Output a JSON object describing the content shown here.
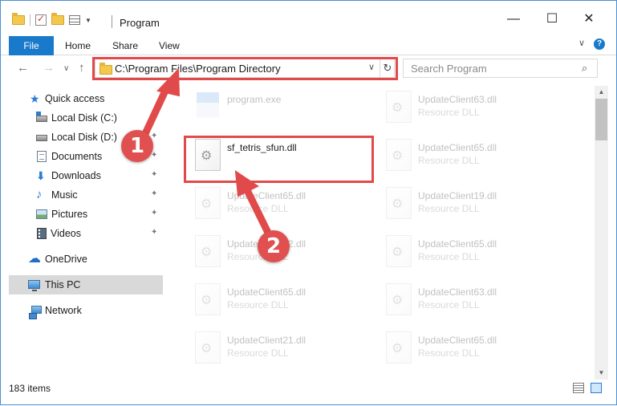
{
  "window": {
    "title": "Program",
    "minimize_glyph": "—",
    "maximize_glyph": "☐",
    "close_glyph": "✕"
  },
  "ribbon": {
    "tabs": [
      {
        "label": "File"
      },
      {
        "label": "Home"
      },
      {
        "label": "Share"
      },
      {
        "label": "View"
      }
    ],
    "expand_glyph": "∨",
    "help_glyph": "?"
  },
  "nav": {
    "back_glyph": "←",
    "forward_glyph": "→",
    "recent_glyph": "∨",
    "up_glyph": "↑",
    "address": "C:\\Program Files\\Program Directory",
    "address_dropdown_glyph": "∨",
    "refresh_glyph": "↻",
    "search_placeholder": "Search Program",
    "search_glyph": "⌕"
  },
  "sidebar": {
    "items": [
      {
        "label": "Quick access",
        "icon": "star-icon",
        "pinned": false
      },
      {
        "label": "Local Disk (C:)",
        "icon": "drive-icon",
        "pinned": true
      },
      {
        "label": "Local Disk (D:)",
        "icon": "drive-icon",
        "pinned": true
      },
      {
        "label": "Documents",
        "icon": "documents-icon",
        "pinned": true
      },
      {
        "label": "Downloads",
        "icon": "downloads-icon",
        "pinned": true
      },
      {
        "label": "Music",
        "icon": "music-icon",
        "pinned": true
      },
      {
        "label": "Pictures",
        "icon": "pictures-icon",
        "pinned": true
      },
      {
        "label": "Videos",
        "icon": "videos-icon",
        "pinned": true
      },
      {
        "label": "OneDrive",
        "icon": "onedrive-icon",
        "pinned": false
      },
      {
        "label": "This PC",
        "icon": "this-pc-icon",
        "pinned": false,
        "selected": true
      },
      {
        "label": "Network",
        "icon": "network-icon",
        "pinned": false
      }
    ],
    "pin_glyph": "📌"
  },
  "files": {
    "left": [
      {
        "name": "program.exe",
        "type": "",
        "kind": "exe",
        "faded": true
      },
      {
        "name": "sf_tetris_sfun.dll",
        "type": "",
        "kind": "dll",
        "faded": false
      },
      {
        "name": "UpdateClient65.dll",
        "type": "Resource DLL",
        "kind": "dll",
        "faded": true
      },
      {
        "name": "UpdateClient62.dll",
        "type": "Resource DLL",
        "kind": "dll",
        "faded": true
      },
      {
        "name": "UpdateClient65.dll",
        "type": "Resource DLL",
        "kind": "dll",
        "faded": true
      },
      {
        "name": "UpdateClient21.dll",
        "type": "Resource DLL",
        "kind": "dll",
        "faded": true
      }
    ],
    "right": [
      {
        "name": "UpdateClient63.dll",
        "type": "Resource DLL",
        "kind": "dll",
        "faded": true
      },
      {
        "name": "UpdateClient65.dll",
        "type": "Resource DLL",
        "kind": "dll",
        "faded": true
      },
      {
        "name": "UpdateClient19.dll",
        "type": "Resource DLL",
        "kind": "dll",
        "faded": true
      },
      {
        "name": "UpdateClient65.dll",
        "type": "Resource DLL",
        "kind": "dll",
        "faded": true
      },
      {
        "name": "UpdateClient63.dll",
        "type": "Resource DLL",
        "kind": "dll",
        "faded": true
      },
      {
        "name": "UpdateClient65.dll",
        "type": "Resource DLL",
        "kind": "dll",
        "faded": true
      }
    ]
  },
  "scrollbar": {
    "up_glyph": "▲",
    "down_glyph": "▼"
  },
  "status": {
    "item_count": "183 items"
  },
  "annotations": {
    "step1": "1",
    "step2": "2",
    "color": "#e04a4a"
  }
}
